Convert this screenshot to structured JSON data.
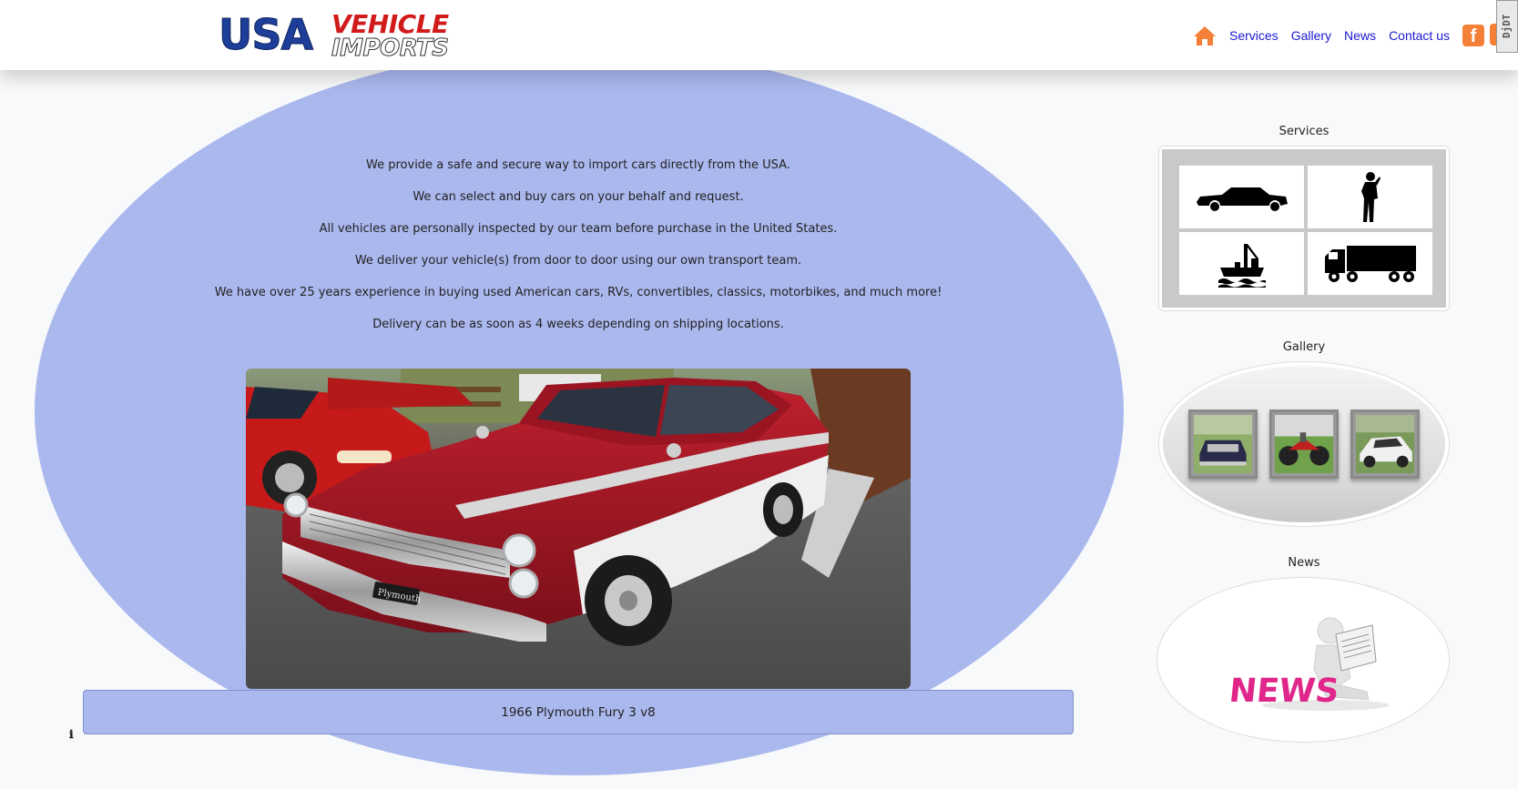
{
  "header": {
    "logo_top": "USA",
    "logo_vehicle": "VEHICLE",
    "logo_imports": "IMPORTS",
    "nav": {
      "home_icon": "home-icon",
      "services": "Services",
      "gallery": "Gallery",
      "news": "News",
      "contact": "Contact us",
      "facebook_icon": "facebook-icon",
      "youtube_icon": "youtube-icon"
    },
    "badge": "DjDT"
  },
  "main": {
    "intro": [
      "We provide a safe and secure way to import cars directly from the USA.",
      "We can select and buy cars on your behalf and request.",
      "All vehicles are personally inspected by our team before purchase in the United States.",
      "We deliver your vehicle(s) from door to door using our own transport team.",
      "We have over 25 years experience in buying used American cars, RVs, convertibles, classics, motorbikes, and much more!",
      "Delivery can be as soon as 4 weeks depending on shipping locations."
    ],
    "caption": "1966 Plymouth Fury 3 v8",
    "plate_text": "Plymouth",
    "info_icon": "ℹ"
  },
  "sidebar": {
    "services_title": "Services",
    "gallery_title": "Gallery",
    "news_title": "News",
    "news_image_text": "NEWS"
  },
  "colors": {
    "accent_blob": "#aab8ee",
    "nav_link": "#1a1ad1",
    "icon_orange": "#f47f37",
    "logo_blue": "#1d3f9a",
    "logo_red": "#d11b1b"
  }
}
